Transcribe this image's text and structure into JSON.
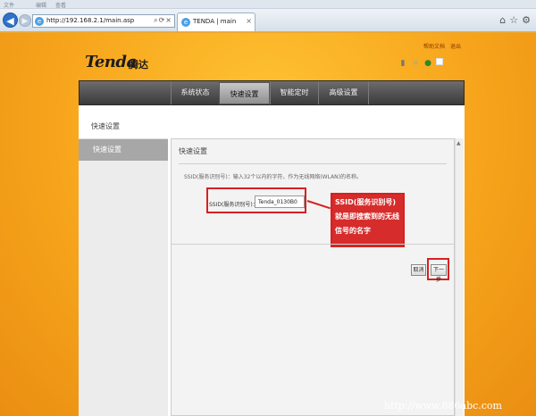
{
  "browser": {
    "menu_items": [
      "文件",
      "编辑",
      "查看"
    ],
    "address": "http://192.168.2.1/main.asp",
    "tab_title": "TENDA | main",
    "window_buttons": [
      "–",
      "□",
      "×"
    ]
  },
  "header": {
    "logo": "Tenda",
    "logo_cn": "腾达",
    "links": [
      "帮助文档",
      "退出"
    ]
  },
  "nav": {
    "items": [
      "系统状态",
      "快速设置",
      "智能定时",
      "高级设置"
    ],
    "active_index": 1
  },
  "page": {
    "heading": "快速设置",
    "sidebar_item": "快速设置",
    "section_title": "快速设置",
    "description": "SSID(服务识别号)：输入32个以内的字符，作为无线网络(WLAN)的名称。",
    "ssid_label": "SSID(服务识别号)：",
    "ssid_value": "Tenda_0130B0",
    "callout": "SSID(服务识别号)就是即搜索到的无线信号的名字",
    "cancel_label": "取消",
    "next_label": "下一步"
  },
  "watermark": "http://www.886abc.com",
  "colors": {
    "accent": "#d82020",
    "background": "#f7a51c",
    "nav": "#4a4a4a"
  }
}
